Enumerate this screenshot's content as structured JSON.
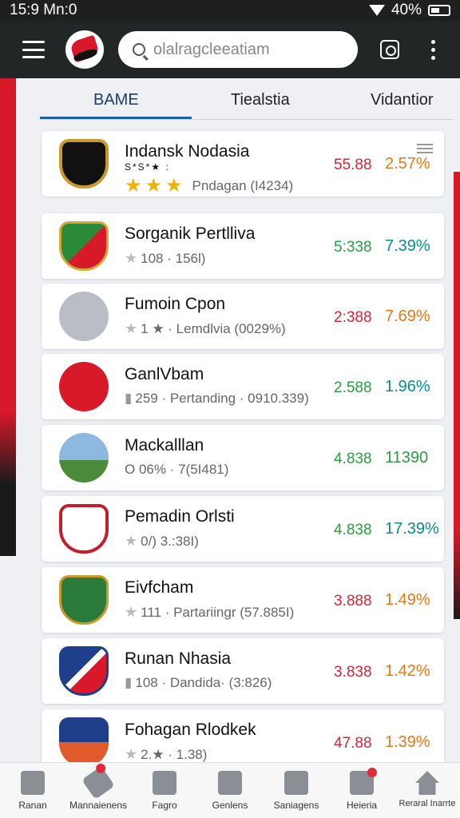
{
  "status_bar": {
    "time": "15:9 Mn:0",
    "battery": "40%"
  },
  "search": {
    "placeholder": "olalragcleeatiam"
  },
  "tabs": [
    {
      "label": "BAME",
      "active": true
    },
    {
      "label": "Tiealstia",
      "active": false
    },
    {
      "label": "Vidantior",
      "active": false
    }
  ],
  "rows": [
    {
      "name": "Indansk Nodasia",
      "mini_stars": "S*S*★ :",
      "sub": "Pndagan (I4234)",
      "value": "55.88",
      "pct": "2.57%",
      "value_color": "red",
      "pct_color": "orange"
    },
    {
      "name": "Sorganik Pertlliva",
      "sub": "108 · 156l)",
      "value": "5:338",
      "pct": "7.39%",
      "value_color": "green",
      "pct_color": "teal"
    },
    {
      "name": "Fumoin Cpon",
      "sub": "1 ★ · Lemdlvia (0029%)",
      "value": "2:388",
      "pct": "7.69%",
      "value_color": "red",
      "pct_color": "orange"
    },
    {
      "name": "GanlVbam",
      "sub": "259 · Pertanding · 0910.339)",
      "value": "2.588",
      "pct": "1.96%",
      "value_color": "green",
      "pct_color": "teal"
    },
    {
      "name": "Mackalllan",
      "sub": "O 06% · 7(5I481)",
      "value": "4.838",
      "pct": "11390",
      "value_color": "green",
      "pct_color": "green"
    },
    {
      "name": "Pemadin Orlsti",
      "sub": "0/) 3.:38I)",
      "value": "4.838",
      "pct": "17.39%",
      "value_color": "green",
      "pct_color": "teal"
    },
    {
      "name": "Eivfcham",
      "sub": "111 · Partariingr (57.885I)",
      "value": "3.888",
      "pct": "1.49%",
      "value_color": "red",
      "pct_color": "orange"
    },
    {
      "name": "Runan Nhasia",
      "sub": "108 · Dandida· (3:826)",
      "value": "3.838",
      "pct": "1.42%",
      "value_color": "red",
      "pct_color": "orange"
    },
    {
      "name": "Fohagan Rlodkek",
      "sub": "2.★ · 1.38)",
      "value": "47.88",
      "pct": "1.39%",
      "value_color": "red",
      "pct_color": "orange"
    }
  ],
  "bottom_nav": [
    {
      "label": "Ranan",
      "icon": "cube-icon"
    },
    {
      "label": "Mannaienens",
      "icon": "tag-icon"
    },
    {
      "label": "Fagro",
      "icon": "box-icon"
    },
    {
      "label": "Genlens",
      "icon": "grid-icon"
    },
    {
      "label": "Saniagens",
      "icon": "monitor-icon"
    },
    {
      "label": "Heieria",
      "icon": "chart-icon"
    },
    {
      "label": "Reraral Inarrte",
      "icon": "home-icon"
    }
  ],
  "colors": {
    "red": "#d0283a",
    "green": "#2a9d3f",
    "orange": "#e07a1a",
    "teal": "#0b8a8f",
    "app_bar": "#232626",
    "accent": "#1f5fa8"
  }
}
